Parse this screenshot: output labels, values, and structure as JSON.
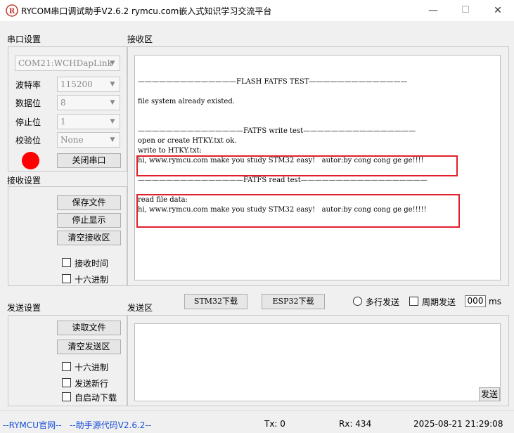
{
  "window": {
    "title": "RYCOM串口调试助手V2.6.2 rymcu.com嵌入式知识学习交流平台",
    "icon": "app-logo-icon",
    "controls": {
      "minimize": "—",
      "maximize": "☐",
      "close": "✕"
    }
  },
  "serial_settings": {
    "title": "串口设置",
    "port": "COM21:WCHDapLink",
    "baud_label": "波特率",
    "baud": "115200",
    "databits_label": "数据位",
    "databits": "8",
    "stopbits_label": "停止位",
    "stopbits": "1",
    "parity_label": "校验位",
    "parity": "None",
    "status_color": "#ff0000",
    "close_port_button": "关闭串口"
  },
  "receive_settings": {
    "title": "接收设置",
    "save_file_button": "保存文件",
    "stop_display_button": "停止显示",
    "clear_receive_button": "清空接收区",
    "receive_time_label": "接收时间",
    "hex_label": "十六进制"
  },
  "receive_area": {
    "title": "接收区",
    "lines": [
      "——————————————FLASH FATFS TEST——————————————",
      "file system already existed.",
      "———————————————FATFS write test————————————————",
      "open or create HTKY.txt ok.",
      "write to HTKY.txt:",
      "hi, www.rymcu.com make you study STM32 easy!   autor:by cong cong ge ge!!!!",
      "———————————————FATFS read test——————————————————",
      "read file data:",
      "hi, www.rymcu.com make you study STM32 easy!   autor:by cong cong ge ge!!!!!"
    ],
    "highlight_color": "#e0202a"
  },
  "send_settings": {
    "title": "发送设置",
    "read_file_button": "读取文件",
    "clear_send_button": "清空发送区",
    "hex_label": "十六进制",
    "newline_label": "发送新行",
    "auto_download_label": "自启动下载"
  },
  "send_area": {
    "title": "发送区",
    "stm32_button": "STM32下载",
    "esp32_button": "ESP32下载",
    "multi_send_label": "多行发送",
    "periodic_label": "周期发送",
    "period_value": "000",
    "period_unit": "ms",
    "send_button": "发送"
  },
  "status_bar": {
    "website_link": "--RYMCU官网--",
    "source_link": "--助手源代码V2.6.2--",
    "tx": "Tx: 0",
    "rx": "Rx: 434",
    "datetime": "2025-08-21 21:29:08",
    "link_color": "#1a4fd6"
  }
}
